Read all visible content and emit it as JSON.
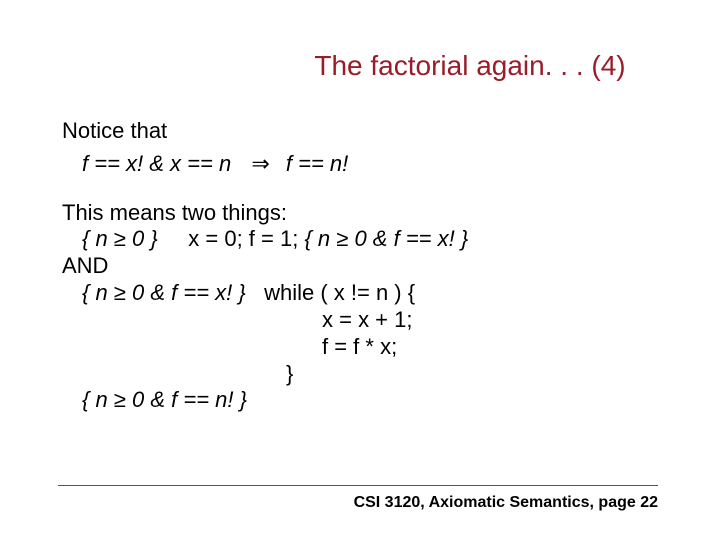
{
  "title": "The factorial again. . . (4)",
  "notice": "Notice that",
  "expr_left": "f == x!  &  x == n",
  "implies": "⇒",
  "expr_right": "f == n!",
  "means": "This means two things:",
  "line1_a": "{ n ≥ 0 }",
  "line1_b": "x = 0; f = 1;",
  "line1_c": "{ n ≥ 0 &  f == x! }",
  "and": "AND",
  "line2_a": "{ n ≥ 0 & f == x! }",
  "line2_b": "while ( x != n ) {",
  "line3": "x = x + 1;",
  "line4": "f = f * x;",
  "line5": "}",
  "line6": "{ n ≥ 0 & f == n! }",
  "footer": "CSI 3120, Axiomatic Semantics, page 22"
}
